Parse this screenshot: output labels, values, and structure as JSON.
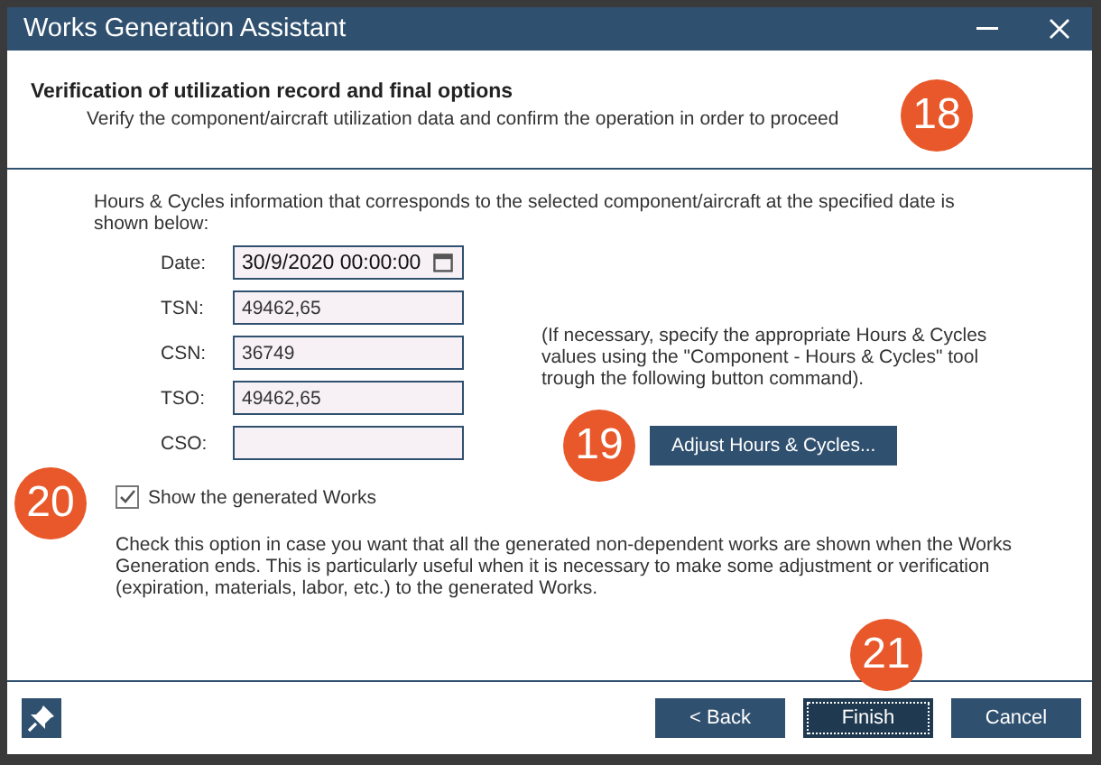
{
  "window": {
    "title": "Works Generation Assistant"
  },
  "header": {
    "title": "Verification of utilization record and final options",
    "subtitle": "Verify the component/aircraft utilization data and confirm the operation in order to proceed"
  },
  "intro": "Hours & Cycles information that corresponds to the selected component/aircraft at the specified date is shown below:",
  "fields": [
    {
      "label": "Date:",
      "value": "30/9/2020 00:00:00",
      "kind": "date"
    },
    {
      "label": "TSN:",
      "value": "49462,65",
      "kind": "text"
    },
    {
      "label": "CSN:",
      "value": "36749",
      "kind": "text"
    },
    {
      "label": "TSO:",
      "value": "49462,65",
      "kind": "text"
    },
    {
      "label": "CSO:",
      "kind": "text"
    }
  ],
  "note": "(If necessary, specify the appropriate Hours & Cycles values using the \"Component - Hours & Cycles\" tool trough the following button command).",
  "adjust_button": "Adjust Hours & Cycles...",
  "option": {
    "label": "Show the generated Works",
    "checked": true,
    "description": "Check this option in case you want that all the generated non-dependent works are shown when the Works Generation ends. This is particularly useful when it is necessary to make some adjustment or verification (expiration, materials, labor, etc.) to the generated Works."
  },
  "buttons": [
    {
      "label": "< Back",
      "focused": false
    },
    {
      "label": "Finish",
      "focused": true
    },
    {
      "label": "Cancel",
      "focused": false
    }
  ],
  "callouts": [
    "18",
    "19",
    "20",
    "21"
  ]
}
